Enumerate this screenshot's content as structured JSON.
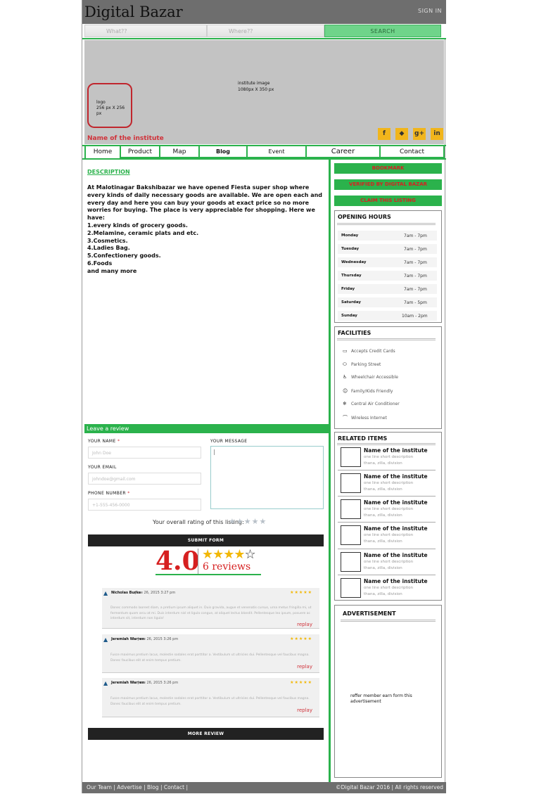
{
  "header": {
    "brand": "Digital Bazar",
    "signin": "SIGN IN"
  },
  "search": {
    "what_placeholder": "What??",
    "where_placeholder": "Where??",
    "button": "SEARCH"
  },
  "banner": {
    "image_label": "institute image",
    "image_size": "1080px X 350 px",
    "logo_label": "logo",
    "logo_size": "256 px X 256 px",
    "institute_name": "Name of the institute"
  },
  "social": [
    {
      "icon": "facebook-icon",
      "glyph": "f"
    },
    {
      "icon": "twitter-icon",
      "glyph": "🐦"
    },
    {
      "icon": "google-plus-icon",
      "glyph": "g+"
    },
    {
      "icon": "linkedin-icon",
      "glyph": "in"
    }
  ],
  "tabs": [
    "Home",
    "Product",
    "Map",
    "Blog",
    "Event",
    "Career",
    "Contact"
  ],
  "description": {
    "heading": "DESCRIPTION",
    "lines": [
      "At Malotinagar Bakshibazar we have opened Fiesta super shop where every kinds of daily necessary goods are available. We are open each and every day and here you can buy your goods at exact price so no more worries for buying. The place is very appreciable for shopping. Here we have:",
      "1.every kinds of grocery goods.",
      "2.Melamine, ceramic plats and etc.",
      "3.Cosmetics.",
      "4.Ladies Bag.",
      "5.Confectionery goods.",
      "6.Foods",
      "and many more"
    ]
  },
  "review_form": {
    "title": "Leave a review",
    "name_label": "YOUR NAME",
    "name_placeholder": "John Doe",
    "email_label": "YOUR EMAIL",
    "email_placeholder": "johndoe@gmail.com",
    "phone_label": "PHONE NUMBER",
    "phone_placeholder": "+1-555-456-0000",
    "message_label": "YOUR MESSAGE",
    "required_mark": "*",
    "rating_label": "Your overall rating of this listing:",
    "rating_stars": "★★★★★",
    "submit": "SUBMIT FORM"
  },
  "rating_summary": {
    "score": "4.0",
    "stars_filled": 4,
    "stars_total": 5,
    "reviews": "6 reviews"
  },
  "reviews": [
    {
      "name": "Nicholas Burke",
      "date": "June 26, 2015 3:27 pm",
      "stars": "★★★★★",
      "text": "Donec commodo laoreet diam, a pretium ipsum aliquet in. Duis gravida, augue et venenatis cursus, urna metus fringilla mi, ut fermentum quam arcu at mi. Duis interdum nisl et ligula congue, at aliquet lectus blandit. Pellentesque leo ipsum, posuere ac interdum sit, interdum non ligula!",
      "reply": "replay"
    },
    {
      "name": "Jeremiah Warren",
      "date": "June 26, 2015 3:26 pm",
      "stars": "★★★★★",
      "text": "Fusce maximus pretium lacus, molestie sodales erat porttitor a. Vestibulum ut ultricies dui. Pellentesque vel faucibus magna. Donec faucibus elit at enim tempus pretium.",
      "reply": "replay"
    },
    {
      "name": "Jeremiah Warren",
      "date": "June 26, 2015 3:26 pm",
      "stars": "★★★★★",
      "text": "Fusce maximus pretium lacus, molestie sodales erat porttitor a. Vestibulum ut ultricies dui. Pellentesque vel faucibus magna. Donec faucibus elit at enim tempus pretium.",
      "reply": "replay"
    }
  ],
  "more_review": "MORE REVIEW",
  "sidebar": {
    "bookmark": "BOOKMARK",
    "verified": "VERIFIED BY DIGITAL BAZAR",
    "claim": "CLAIM THIS LISTING",
    "hours_title": "OPENING HOURS",
    "hours": [
      {
        "day": "Monday",
        "time": "7am - 7pm"
      },
      {
        "day": "Tuesday",
        "time": "7am - 7pm"
      },
      {
        "day": "Wednesday",
        "time": "7am - 7pm"
      },
      {
        "day": "Thursday",
        "time": "7am - 7pm"
      },
      {
        "day": "Friday",
        "time": "7am - 7pm"
      },
      {
        "day": "Saturday",
        "time": "7am - 5pm"
      },
      {
        "day": "Sunday",
        "time": "10am - 2pm"
      }
    ],
    "facilities_title": "FACILITIES",
    "facilities": [
      {
        "icon": "credit-card-icon",
        "glyph": "▭",
        "label": "Accepts Credit Cards"
      },
      {
        "icon": "car-icon",
        "glyph": "⬭",
        "label": "Parking Street"
      },
      {
        "icon": "wheelchair-icon",
        "glyph": "♿",
        "label": "Wheelchair Accessible"
      },
      {
        "icon": "family-icon",
        "glyph": "☺",
        "label": "Family/Kids Friendly"
      },
      {
        "icon": "snowflake-icon",
        "glyph": "❄",
        "label": "Central Air Conditioner"
      },
      {
        "icon": "wifi-icon",
        "glyph": "⌒",
        "label": "Wireless Internet"
      }
    ],
    "related_title": "RELATED ITEMS",
    "related": [
      {
        "name": "Name of the institute",
        "desc": "one line short description",
        "location": "thana, zilla, division"
      },
      {
        "name": "Name of the institute",
        "desc": "one line short description",
        "location": "thana, zilla, division"
      },
      {
        "name": "Name of the institute",
        "desc": "one line short description",
        "location": "thana, zilla, division"
      },
      {
        "name": "Name of the institute",
        "desc": "one line short description",
        "location": "thana, zilla, division"
      },
      {
        "name": "Name of the institute",
        "desc": "one line short description",
        "location": "thana, zilla, division"
      },
      {
        "name": "Name of the institute",
        "desc": "one line short description",
        "location": "thana, zilla, division"
      }
    ],
    "ad_title": "ADVERTISEMENT",
    "ad_text": "reffer member earn form this advertisement"
  },
  "footer": {
    "links": [
      "Our Team",
      "Advertise",
      "Blog",
      "Contact"
    ],
    "copyright": "©Digital Bazar 2016 | All rights reserved"
  },
  "colors": {
    "accent": "#2bb24c",
    "brand_red": "#d0323a",
    "social": "#f1b51c",
    "topbar": "#6e6e6e"
  }
}
